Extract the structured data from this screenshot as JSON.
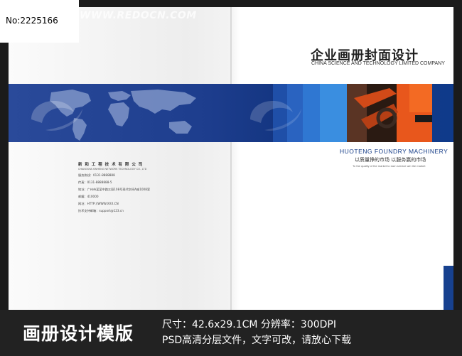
{
  "id_label": "No:2225166",
  "watermark": "WWW.REDOCN.COM",
  "cover": {
    "title_zh": "企业画册封面设计",
    "title_en": "CHINA SCIENCE AND TECHNOLOGY LIMITED COMPANY",
    "foundry": "HUOTENG FOUNDRY MACHINERY",
    "slogan": "以质量挣的市场 以服务赢的市场",
    "slogan_en": "To the quality of the market to earn service win the market",
    "company": {
      "name": "新 和 工 程 技 术 有 限 公 司",
      "name_en": "CHANGSHA XINHENG NETWORK TECHNOLOGY CO., LTD",
      "lines": [
        "服务热线：0131-8888888",
        "传真：0131-8888888-5",
        "地址：广州市某某中路三段108号现代空间A座1008室",
        "邮编：410000",
        "网址：HTTP://WWW.XXX.CN",
        "技术支持邮箱：support@123.cn"
      ]
    }
  },
  "footer": {
    "title": "画册设计模版",
    "spec_line1": "尺寸：42.6x29.1CM  分辨率：300DPI",
    "spec_line2": "PSD高清分层文件，文字可改，请放心下载"
  },
  "colors": {
    "band_blue": "#1d3d8d",
    "accent_navy": "#17418f",
    "footer_bg": "#222222"
  }
}
